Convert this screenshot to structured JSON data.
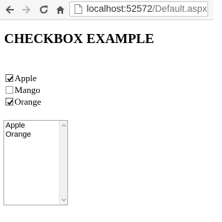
{
  "browser": {
    "url_host": "localhost:52572",
    "url_path": "/Default.aspx",
    "icons": {
      "back": "back-arrow-icon",
      "forward": "forward-arrow-icon",
      "reload": "reload-icon",
      "home": "home-icon",
      "page": "page-icon"
    }
  },
  "page": {
    "title": "CHECKBOX EXAMPLE",
    "checkboxes": [
      {
        "label": "Apple",
        "checked": true
      },
      {
        "label": "Mango",
        "checked": false
      },
      {
        "label": "Orange",
        "checked": true
      }
    ],
    "listbox": {
      "items": [
        "Apple",
        "Orange"
      ]
    }
  }
}
